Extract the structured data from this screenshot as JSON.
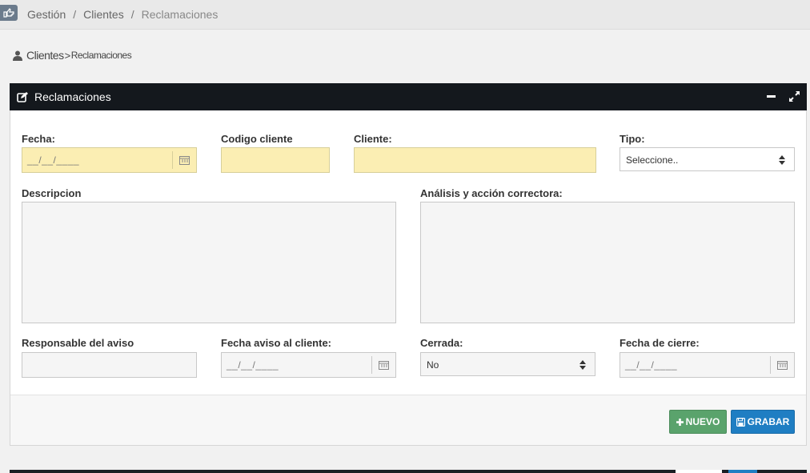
{
  "breadcrumb": {
    "items": [
      "Gestión",
      "Clientes",
      "Reclamaciones"
    ],
    "separator": "/"
  },
  "subtitle": {
    "section": "Clientes",
    "separator": ">",
    "page": "Reclamaciones"
  },
  "panel": {
    "title": "Reclamaciones"
  },
  "form": {
    "fecha": {
      "label": "Fecha:",
      "placeholder": "__/__/____"
    },
    "codigo_cliente": {
      "label": "Codigo cliente",
      "value": ""
    },
    "cliente": {
      "label": "Cliente:",
      "value": ""
    },
    "tipo": {
      "label": "Tipo:",
      "selected": "Seleccione.."
    },
    "descripcion": {
      "label": "Descripcion",
      "value": ""
    },
    "analisis": {
      "label": "Análisis y acción correctora:",
      "value": ""
    },
    "responsable": {
      "label": "Responsable del aviso",
      "value": ""
    },
    "fecha_aviso": {
      "label": "Fecha aviso al cliente:",
      "placeholder": "__/__/____"
    },
    "cerrada": {
      "label": "Cerrada:",
      "selected": "No"
    },
    "fecha_cierre": {
      "label": "Fecha de cierre:",
      "placeholder": "__/__/____"
    }
  },
  "buttons": {
    "nuevo": "NUEVO",
    "grabar": "GRABAR"
  },
  "colors": {
    "required_field": "#fbeeb3",
    "header": "#14181d",
    "nuevo_button": "#5aa36c",
    "grabar_button": "#1f7ec3"
  },
  "icons": [
    "hand-point-icon",
    "user-icon",
    "edit-icon",
    "minus-icon",
    "expand-icon",
    "calendar-icon",
    "plus-icon",
    "floppy-icon"
  ]
}
